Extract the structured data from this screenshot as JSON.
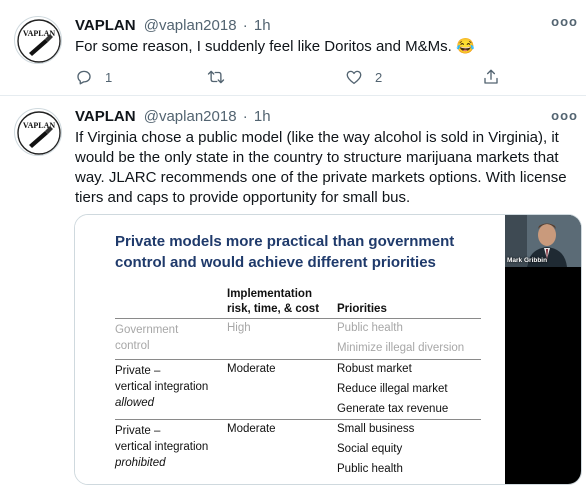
{
  "tweets": [
    {
      "name": "VAPLAN",
      "handle": "@vaplan2018",
      "sep": "·",
      "time": "1h",
      "avatar_text": "VAPLAN",
      "text": "For some reason, I suddenly feel like Doritos and M&Ms. 😂",
      "reply_count": "1",
      "like_count": "2"
    },
    {
      "name": "VAPLAN",
      "handle": "@vaplan2018",
      "sep": "·",
      "time": "1h",
      "avatar_text": "VAPLAN",
      "text": "If Virginia chose a public model (like the way alcohol is sold in Virginia), it would be the only state in the country to structure marijuana markets that way. JLARC recommends one of the private markets options. With license tiers and caps to provide opportunity for small bus."
    }
  ],
  "more_glyph": "ooo",
  "slide": {
    "title_line1": "Private models more practical than government",
    "title_line2": "control and would achieve different priorities",
    "header_impl_1": "Implementation",
    "header_impl_2": "risk, time, & cost",
    "header_priorities": "Priorities",
    "rows": [
      {
        "model": [
          "Government",
          "control"
        ],
        "impl": "High",
        "priorities": [
          "Public health",
          "Minimize illegal diversion"
        ]
      },
      {
        "model": [
          "Private –",
          "vertical integration",
          "allowed"
        ],
        "impl": "Moderate",
        "priorities": [
          "Robust market",
          "Reduce illegal market",
          "Generate tax revenue"
        ]
      },
      {
        "model": [
          "Private –",
          "vertical integration",
          "prohibited"
        ],
        "impl": "Moderate",
        "priorities": [
          "Small business",
          "Social equity",
          "Public health"
        ]
      }
    ]
  },
  "video": {
    "speaker_name": "Mark Gribbin"
  },
  "icons": [
    "reply-icon",
    "retweet-icon",
    "like-icon",
    "share-icon",
    "more-icon"
  ],
  "colors": {
    "slide_title": "#1f3a6b",
    "meta": "#536471",
    "divider": "#e6ecf0"
  }
}
